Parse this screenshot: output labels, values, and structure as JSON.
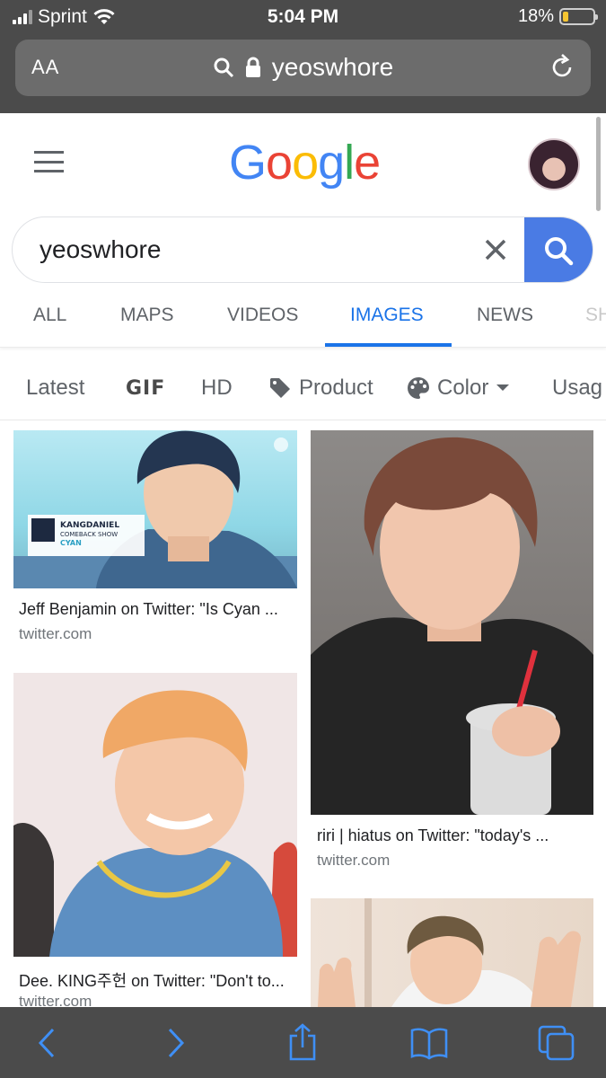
{
  "status_bar": {
    "carrier": "Sprint",
    "time": "5:04 PM",
    "battery": "18%",
    "battery_level": 0.18
  },
  "url_bar": {
    "text_size_label": "AA",
    "url": "yeoswhore"
  },
  "google": {
    "logo": "Google",
    "query": "yeoswhore",
    "tabs": [
      "ALL",
      "MAPS",
      "VIDEOS",
      "IMAGES",
      "NEWS",
      "SH"
    ],
    "active_tab": "IMAGES",
    "filters": [
      "Latest",
      "GIF",
      "HD",
      "Product",
      "Color",
      "Usag"
    ]
  },
  "results": [
    {
      "title": "Jeff Benjamin on Twitter: \"Is Cyan ...",
      "source": "twitter.com"
    },
    {
      "title": "riri | hiatus on Twitter: \"today's ...",
      "source": "twitter.com"
    },
    {
      "title": "Dee. KING주헌 on Twitter: \"Don't to...",
      "source": "twitter.com"
    }
  ],
  "thumb_text": {
    "line1": "KANGDANIEL",
    "line2": "COMEBACK SHOW",
    "line3": "CYAN"
  },
  "colors": {
    "accent": "#1a73e8",
    "chrome": "#4b4b4b",
    "search_button": "#4a7be4",
    "toolbar_icon": "#3f8ff5"
  },
  "toolbar": [
    "back-icon",
    "forward-icon",
    "share-icon",
    "bookmarks-icon",
    "tabs-icon"
  ]
}
